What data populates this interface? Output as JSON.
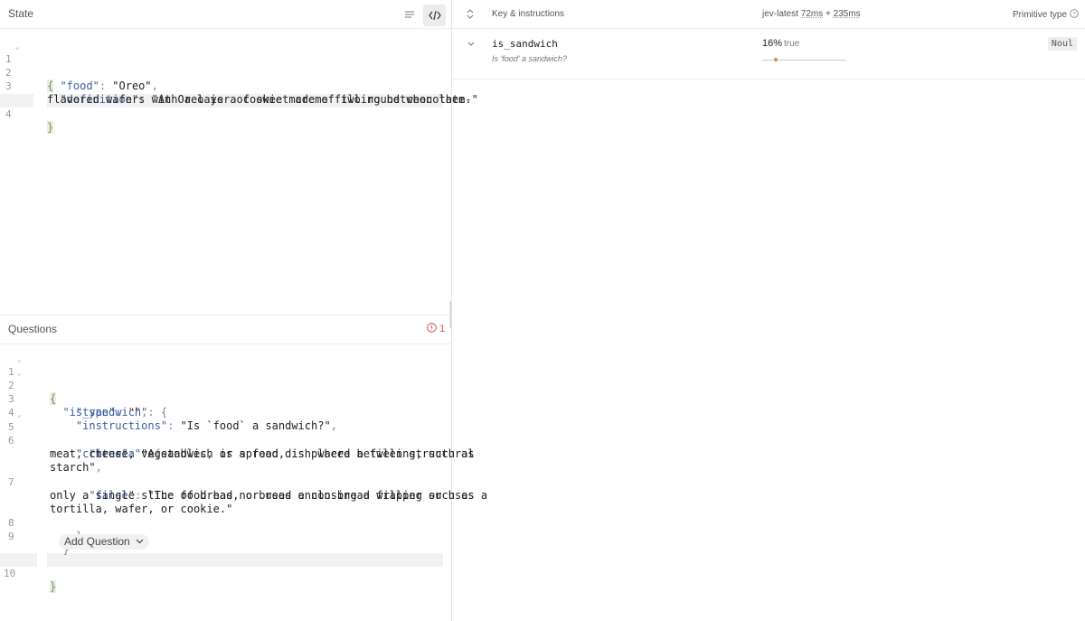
{
  "state_panel": {
    "title": "State",
    "code": {
      "line_numbers": [
        "1",
        "2",
        "3",
        "4"
      ],
      "lines": {
        "l1": "{",
        "l2_key": "\"food\"",
        "l2_val": "\"Oreo\"",
        "l3_key": "\"definition\"",
        "l3_val_a": "\"An Oreo is a cookie made of two round chocolate-",
        "l3_val_b": "flavored wafers with a layer of sweet creme filling between them.\"",
        "l4": "}"
      }
    }
  },
  "questions_panel": {
    "title": "Questions",
    "error_count": "1",
    "add_question_label": "Add Question",
    "code": {
      "line_numbers": [
        "1",
        "2",
        "3",
        "4",
        "5",
        "6",
        "7",
        "8",
        "9",
        "10"
      ],
      "lines": {
        "l1": "{",
        "l2_key": "\"is_sandwich\"",
        "l2_rest": "{",
        "l3_key": "\"type\"",
        "l3_val": "\"\"",
        "l4_key": "\"instructions\"",
        "l4_val": "\"Is `food` a sandwich?\"",
        "l5_key": "\"criteria\"",
        "l5_rest": "{",
        "l6_key": "\"true\"",
        "l6_val_a": "\"A sandwich is a food dish where a filling, such as",
        "l6_val_b": "meat, cheese, vegetables, or spread, is placed between structural",
        "l6_val_c": "starch\"",
        "l7_key": "\"false\"",
        "l7_val_a": "\"The food has no bread enclosing a filling or uses",
        "l7_val_b": "only a single slice of bread, or uses a non-bread wrapper such as a",
        "l7_val_c": "tortilla, wafer, or cookie.\"",
        "l8": "}",
        "l9": "}",
        "l10": "}"
      }
    }
  },
  "results": {
    "header": {
      "key_col": "Key & instructions",
      "model": "jev-latest",
      "time1": "72ms",
      "plus": "+",
      "time2": "235ms",
      "type_col": "Primitive type"
    },
    "rows": [
      {
        "key": "is_sandwich",
        "instruction": "Is 'food' a sandwich?",
        "percent": "16%",
        "answer": "true",
        "probability": 0.16,
        "type_badge": "Noul"
      }
    ]
  },
  "colors": {
    "accent_orange": "#e8893a",
    "error_red": "#d9534f"
  }
}
